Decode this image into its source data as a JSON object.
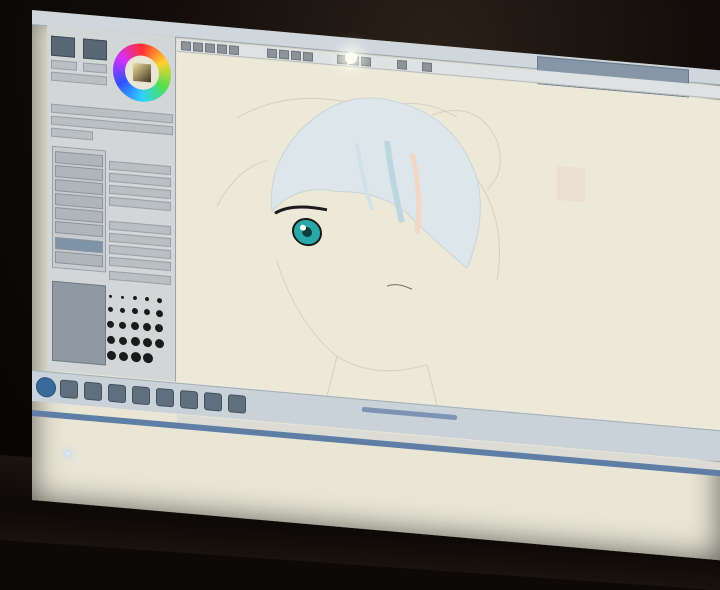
{
  "window": {
    "title_text": "",
    "user_badge_text": ""
  },
  "statusbar": {
    "text": ""
  },
  "taskbar": {
    "clock_time": "",
    "clock_date": ""
  },
  "colors": {
    "canvas": "#ece9d8",
    "panel": "#d3d6d6",
    "hair": "#d8e4ea",
    "eye": "#2aa8a8",
    "accent": "#5f7ea6"
  },
  "icons": [
    "start-orb-icon",
    "browser-icon",
    "folder-icon",
    "media-icon",
    "paint-app-icon",
    "explorer-icon",
    "color-wheel-icon"
  ]
}
